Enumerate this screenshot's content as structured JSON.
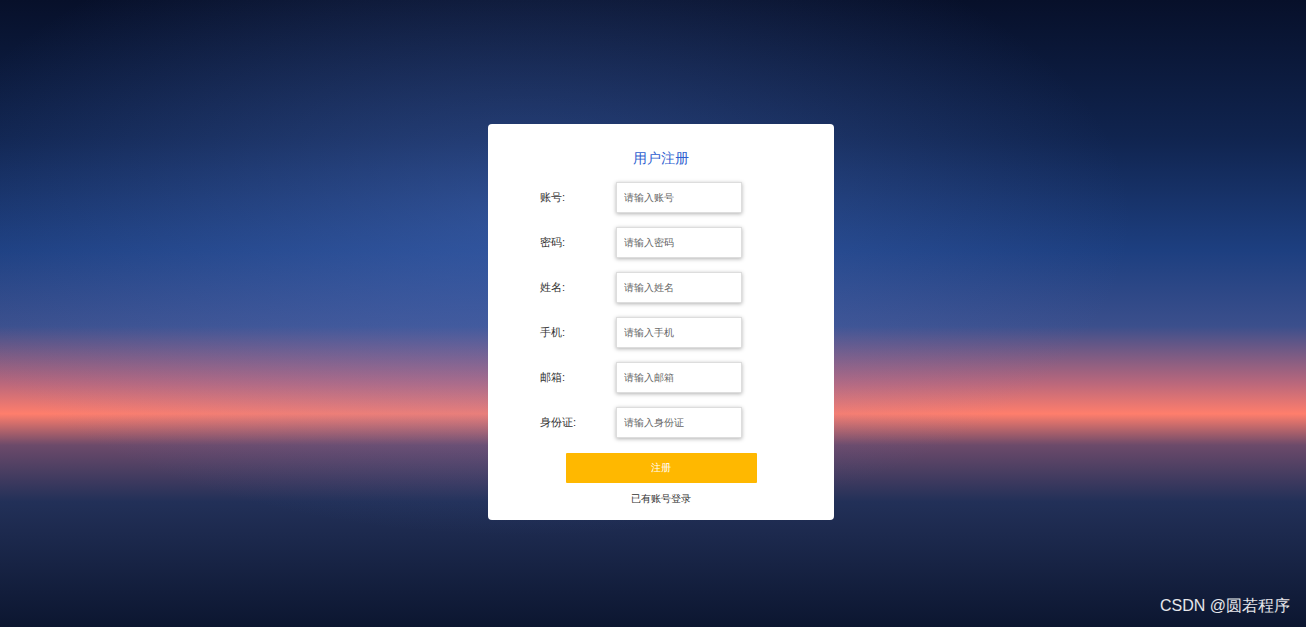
{
  "form": {
    "title": "用户注册",
    "fields": [
      {
        "label": "账号:",
        "placeholder": "请输入账号"
      },
      {
        "label": "密码:",
        "placeholder": "请输入密码"
      },
      {
        "label": "姓名:",
        "placeholder": "请输入姓名"
      },
      {
        "label": "手机:",
        "placeholder": "请输入手机"
      },
      {
        "label": "邮箱:",
        "placeholder": "请输入邮箱"
      },
      {
        "label": "身份证:",
        "placeholder": "请输入身份证"
      }
    ],
    "submit": "注册",
    "login_link": "已有账号登录"
  },
  "watermark": "CSDN @圆若程序"
}
